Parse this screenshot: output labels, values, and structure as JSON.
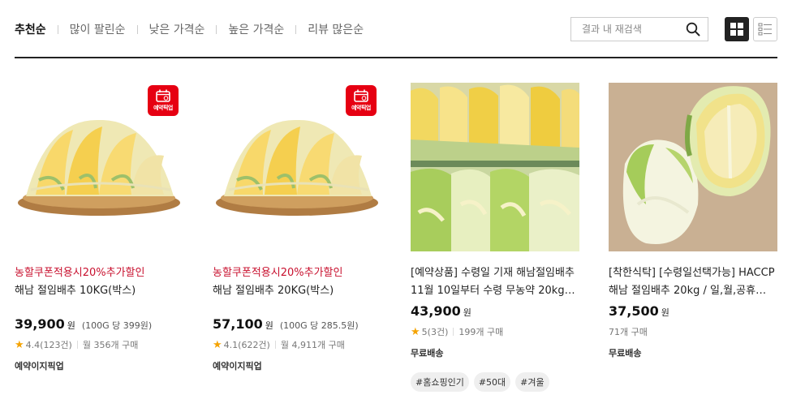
{
  "sort": {
    "tabs": [
      {
        "label": "추천순"
      },
      {
        "label": "많이 팔린순"
      },
      {
        "label": "낮은 가격순"
      },
      {
        "label": "높은 가격순"
      },
      {
        "label": "리뷰 많은순"
      }
    ]
  },
  "search": {
    "placeholder": "결과 내 재검색",
    "icon": "search-icon"
  },
  "view": {
    "grid_icon": "grid-view-icon",
    "list_icon": "list-view-icon"
  },
  "products": [
    {
      "badge": "예약픽업",
      "promo": "농할쿠폰적용시20%추가할인",
      "name_line1": "해남 절임배추 10KG(박스)",
      "price": "39,900",
      "won": "원",
      "unit_price": "(100G 당 399원)",
      "rating": "4.4(123건)",
      "purchases": "월 356개 구매",
      "tag": "예약이지픽업"
    },
    {
      "badge": "예약픽업",
      "promo": "농할쿠폰적용시20%추가할인",
      "name_line1": "해남 절임배추 20KG(박스)",
      "price": "57,100",
      "won": "원",
      "unit_price": "(100G 당 285.5원)",
      "rating": "4.1(622건)",
      "purchases": "월 4,911개 구매",
      "tag": "예약이지픽업"
    },
    {
      "name_line1": "[예약상품] 수령일 기재 해남절임배추",
      "name_line2": "11월 10일부터 수령 무농약 20kg…",
      "price": "43,900",
      "won": "원",
      "rating": "5(3건)",
      "purchases": "199개 구매",
      "tag": "무료배송",
      "hashtags": [
        "#홈쇼핑인기",
        "#50대",
        "#겨울"
      ]
    },
    {
      "name_line1": "[착한식탁] [수령일선택가능] HACCP",
      "name_line2": "해남 절임배추 20kg / 일,월,공휴…",
      "price": "37,500",
      "won": "원",
      "purchases": "71개 구매",
      "tag": "무료배송"
    }
  ],
  "colors": {
    "promo": "#c8102e",
    "star": "#f5a300",
    "badge": "#e60012",
    "active_view": "#222222"
  }
}
